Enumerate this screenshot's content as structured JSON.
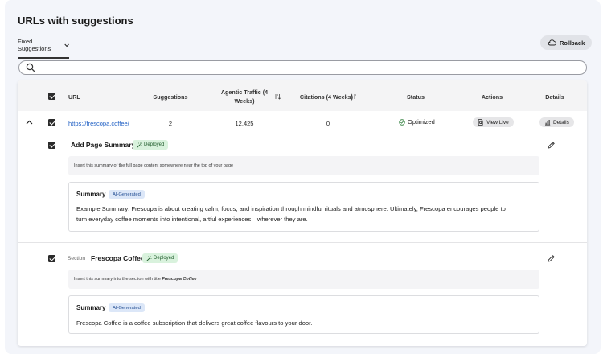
{
  "header": {
    "title": "URLs with suggestions"
  },
  "tabs": {
    "active_label": "Fixed Suggestions"
  },
  "toolbar": {
    "rollback_label": "Rollback"
  },
  "search": {
    "placeholder": "",
    "value": ""
  },
  "table": {
    "columns": {
      "url": "URL",
      "suggestions": "Suggestions",
      "agentic_traffic_line1": "Agentic Traffic (4",
      "agentic_traffic_line2": "Weeks)",
      "citations": "Citations (4 Weeks)",
      "status": "Status",
      "actions": "Actions",
      "details": "Details"
    },
    "row": {
      "url": "https://frescopa.coffee/",
      "suggestions": "2",
      "agentic_traffic": "12,425",
      "citations": "0",
      "status": "Optimized",
      "action_label": "View Live",
      "details_label": "Details"
    }
  },
  "suggestions": [
    {
      "title": "Add Page Summary",
      "badge": "Deployed",
      "instruction": "Insert this summary of the full page content somewhere near the top of your page",
      "summary_heading": "Summary",
      "summary_badge": "AI-Generated",
      "summary_line1": "Example Summary: Frescopa is about creating calm, focus, and inspiration through mindful rituals and atmosphere. Ultimately, Frescopa encourages people to",
      "summary_line2": "turn everyday coffee moments into intentional, artful experiences—wherever they are."
    },
    {
      "section_label": "Section",
      "title": "Frescopa Coffee",
      "badge": "Deployed",
      "instruction_prefix": "Insert this summary into the section with title ",
      "instruction_emph": "Frescopa Coffee",
      "summary_heading": "Summary",
      "summary_badge": "AI-Generated",
      "summary_line1": "Frescopa Coffee is a coffee subscription that delivers great coffee flavours to your door."
    }
  ],
  "colors": {
    "link": "#1f5fc4",
    "deployed_bg": "#d9f2dd",
    "ai_badge_bg": "#dce7f8",
    "status_ok": "#2d7d3a"
  }
}
